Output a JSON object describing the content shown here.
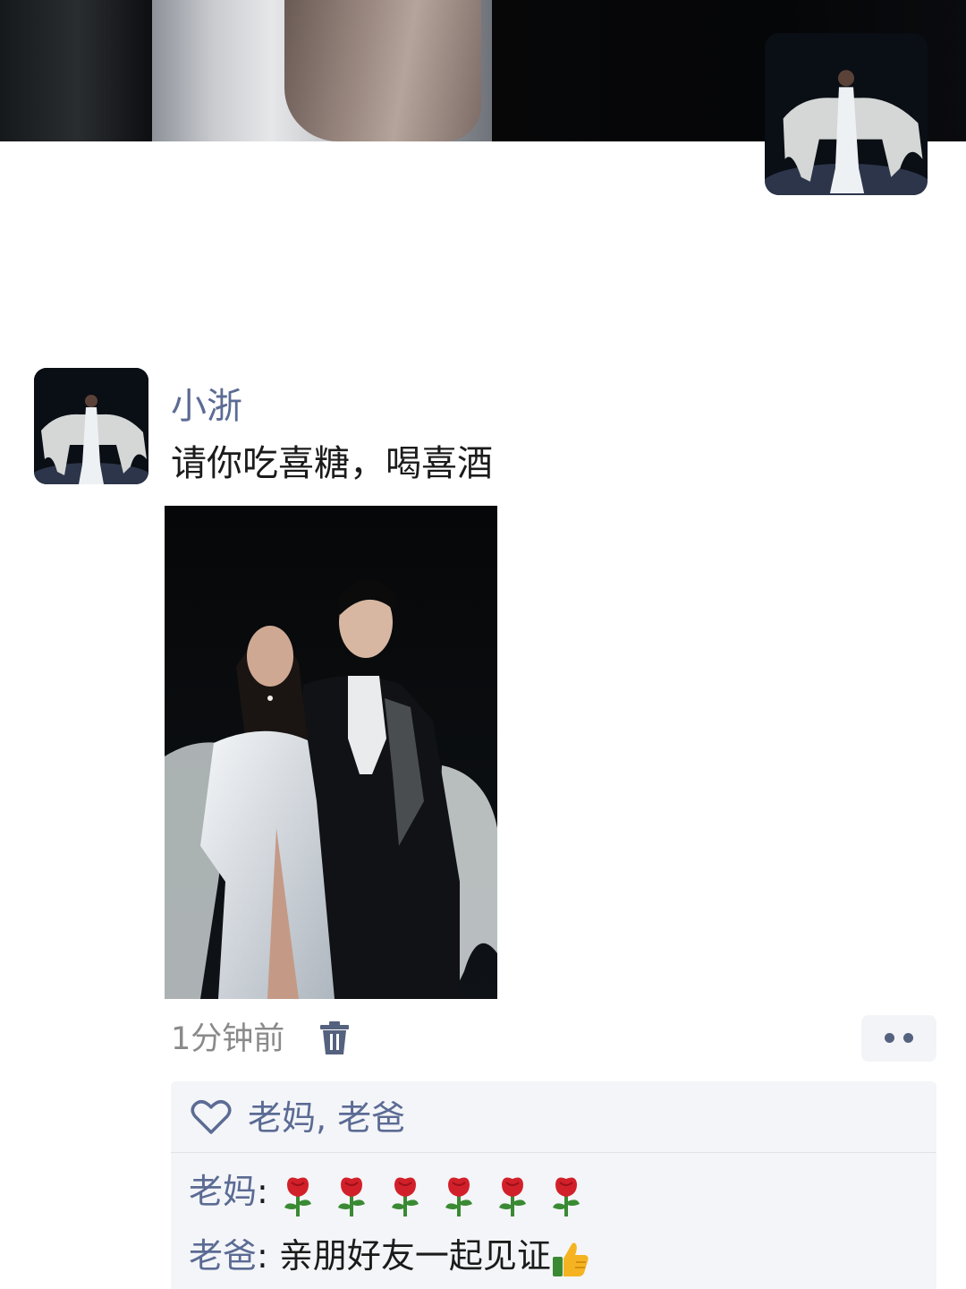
{
  "post": {
    "username": "小浙",
    "text": "请你吃喜糖，喝喜酒",
    "timestamp": "1分钟前"
  },
  "likes": {
    "names": "老妈, 老爸"
  },
  "comments": [
    {
      "author": "老妈",
      "separator": ": ",
      "text": "",
      "emoji": "rose-icon x6"
    },
    {
      "author": "老爸",
      "separator": ": ",
      "text": "亲朋好友一起见证",
      "emoji": "thumbs-up-icon"
    }
  ],
  "icons": {
    "delete": "trash-icon",
    "more": "more-dots-icon",
    "like": "heart-icon"
  },
  "colors": {
    "name_link": "#5b6b94",
    "panel_bg": "#f4f5f8",
    "text": "#1b1b1b",
    "muted": "#8a8a8a"
  }
}
